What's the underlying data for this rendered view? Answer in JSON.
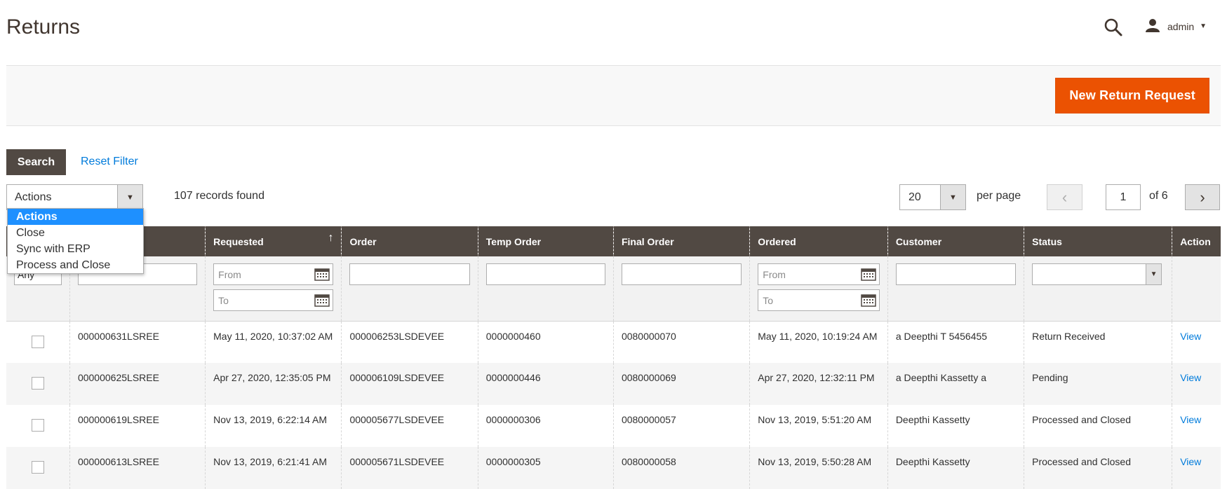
{
  "header": {
    "title": "Returns",
    "user": "admin"
  },
  "toolbar": {
    "new_button": "New Return Request",
    "search_button": "Search",
    "reset_filter": "Reset Filter"
  },
  "massaction": {
    "selected": "Actions",
    "options": [
      "Actions",
      "Close",
      "Sync with ERP",
      "Process and Close"
    ]
  },
  "records_found": "107 records found",
  "pager": {
    "per_page_value": "20",
    "per_page_label": "per page",
    "current_page": "1",
    "of_label": "of 6"
  },
  "table": {
    "columns": [
      "",
      "",
      "Requested",
      "Order",
      "Temp Order",
      "Final Order",
      "Ordered",
      "Customer",
      "Status",
      "Action"
    ],
    "filters": {
      "any": "Any",
      "from_placeholder": "From",
      "to_placeholder": "To"
    },
    "rows": [
      {
        "id": "000000631LSREE",
        "requested": "May 11, 2020, 10:37:02 AM",
        "order": "000006253LSDEVEE",
        "temp_order": "0000000460",
        "final_order": "0080000070",
        "ordered": "May 11, 2020, 10:19:24 AM",
        "customer": "a Deepthi T 5456455",
        "status": "Return Received",
        "action": "View"
      },
      {
        "id": "000000625LSREE",
        "requested": "Apr 27, 2020, 12:35:05 PM",
        "order": "000006109LSDEVEE",
        "temp_order": "0000000446",
        "final_order": "0080000069",
        "ordered": "Apr 27, 2020, 12:32:11 PM",
        "customer": "a Deepthi Kassetty a",
        "status": "Pending",
        "action": "View"
      },
      {
        "id": "000000619LSREE",
        "requested": "Nov 13, 2019, 6:22:14 AM",
        "order": "000005677LSDEVEE",
        "temp_order": "0000000306",
        "final_order": "0080000057",
        "ordered": "Nov 13, 2019, 5:51:20 AM",
        "customer": "Deepthi Kassetty",
        "status": "Processed and Closed",
        "action": "View"
      },
      {
        "id": "000000613LSREE",
        "requested": "Nov 13, 2019, 6:21:41 AM",
        "order": "000005671LSDEVEE",
        "temp_order": "0000000305",
        "final_order": "0080000058",
        "ordered": "Nov 13, 2019, 5:50:28 AM",
        "customer": "Deepthi Kassetty",
        "status": "Processed and Closed",
        "action": "View"
      }
    ]
  },
  "colors": {
    "accent": "#eb5202",
    "header_bg": "#514943",
    "link": "#007bdb",
    "dropdown_selected": "#1e90ff"
  },
  "icons": {
    "search": "search-icon",
    "user": "user-icon",
    "calendar": "calendar-icon"
  }
}
